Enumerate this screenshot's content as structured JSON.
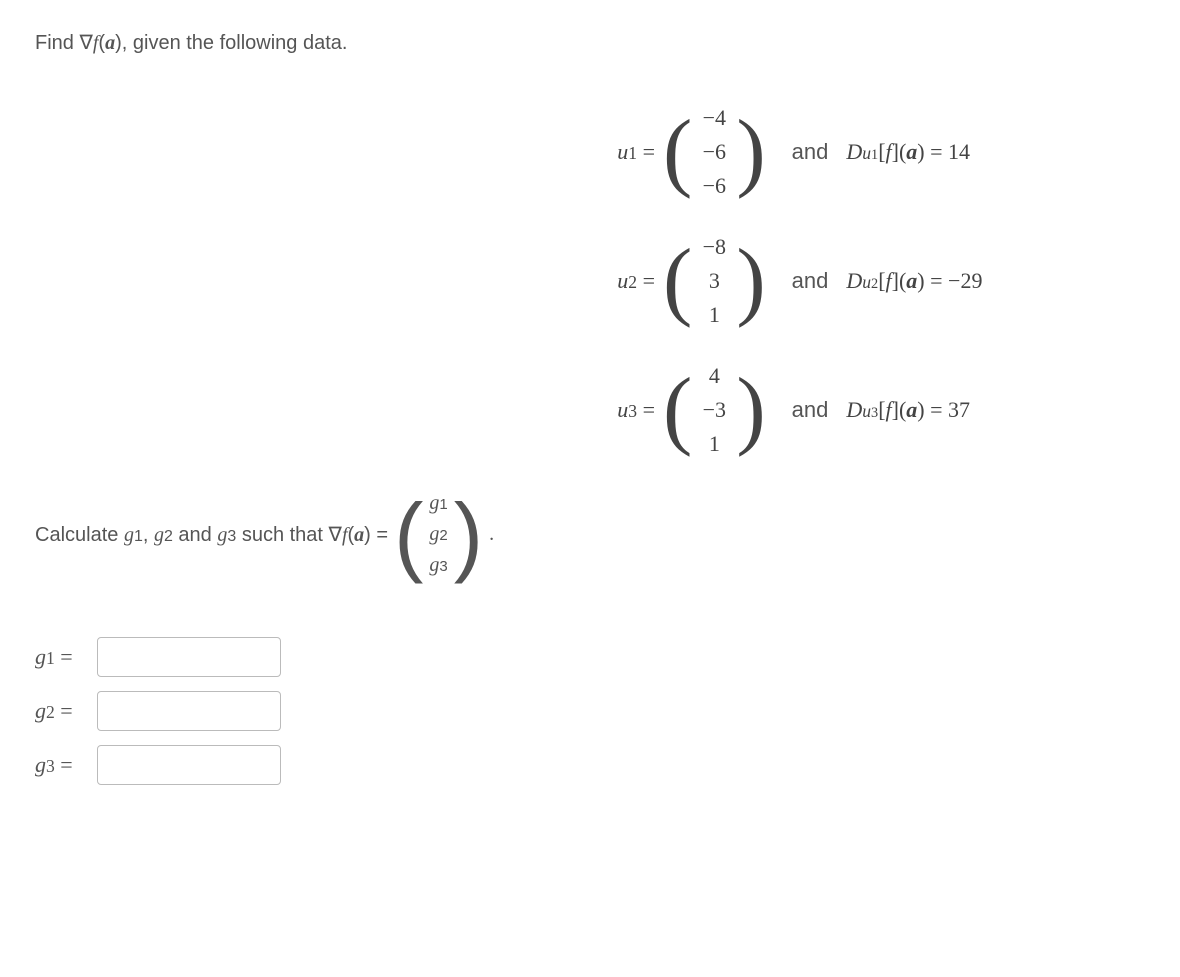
{
  "prompt_prefix": "Find ",
  "prompt_suffix": ", given the following data.",
  "vectors": [
    {
      "label": "u",
      "sub": "1",
      "entries": [
        "−4",
        "−6",
        "−6"
      ],
      "deriv_label_pre": "and  D",
      "deriv_sub": "u",
      "deriv_subsub": "1",
      "deriv_arg": "[f](a) = 14"
    },
    {
      "label": "u",
      "sub": "2",
      "entries": [
        "−8",
        "3",
        "1"
      ],
      "deriv_label_pre": "and  D",
      "deriv_sub": "u",
      "deriv_subsub": "2",
      "deriv_arg": "[f](a) = −29"
    },
    {
      "label": "u",
      "sub": "3",
      "entries": [
        "4",
        "−3",
        "1"
      ],
      "deriv_label_pre": "and  D",
      "deriv_sub": "u",
      "deriv_subsub": "3",
      "deriv_arg": "[f](a) = 37"
    }
  ],
  "calc_prefix": "Calculate ",
  "calc_vars": "g₁, g₂ and g₃",
  "calc_mid": " such that ",
  "calc_suffix": " = ",
  "grad_expr": "∇f(a)",
  "grad_vec": [
    "g₁",
    "g₂",
    "g₃"
  ],
  "period": ".",
  "answers": [
    {
      "label": "g",
      "sub": "1"
    },
    {
      "label": "g",
      "sub": "2"
    },
    {
      "label": "g",
      "sub": "3"
    }
  ]
}
